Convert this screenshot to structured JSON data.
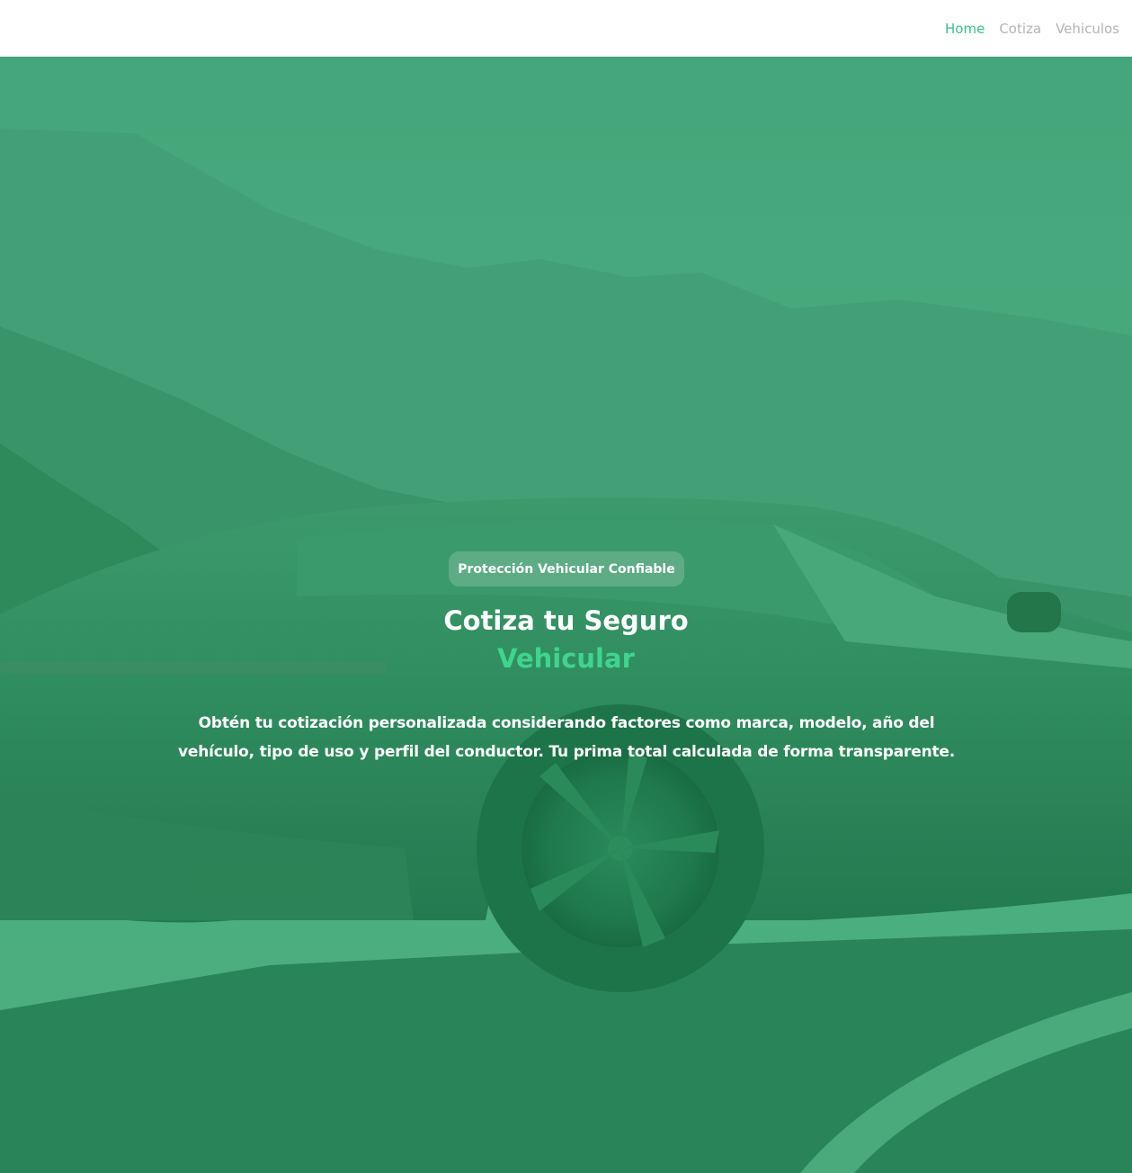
{
  "nav": {
    "links": [
      {
        "label": "Home",
        "active": true
      },
      {
        "label": "Cotiza",
        "active": false
      },
      {
        "label": "Vehiculos",
        "active": false
      }
    ],
    "active_color": "#3cc287",
    "inactive_color": "#b4b4b4"
  },
  "hero": {
    "background_image": "green-tinted-sports-car-on-mountain-road",
    "overlay_color": "#45a67b",
    "badge": "Protección Vehicular Confiable",
    "title_line1": "Cotiza tu Seguro",
    "title_line2": "Vehicular",
    "title_accent_color": "#3fd58e",
    "description_before": "Obtén tu cotización personalizada considerando factores como marca, modelo, año del vehículo, tipo de uso y perfil del conductor. Tu ",
    "description_bold": "prima total",
    "description_after": " calculada de forma transparente."
  }
}
